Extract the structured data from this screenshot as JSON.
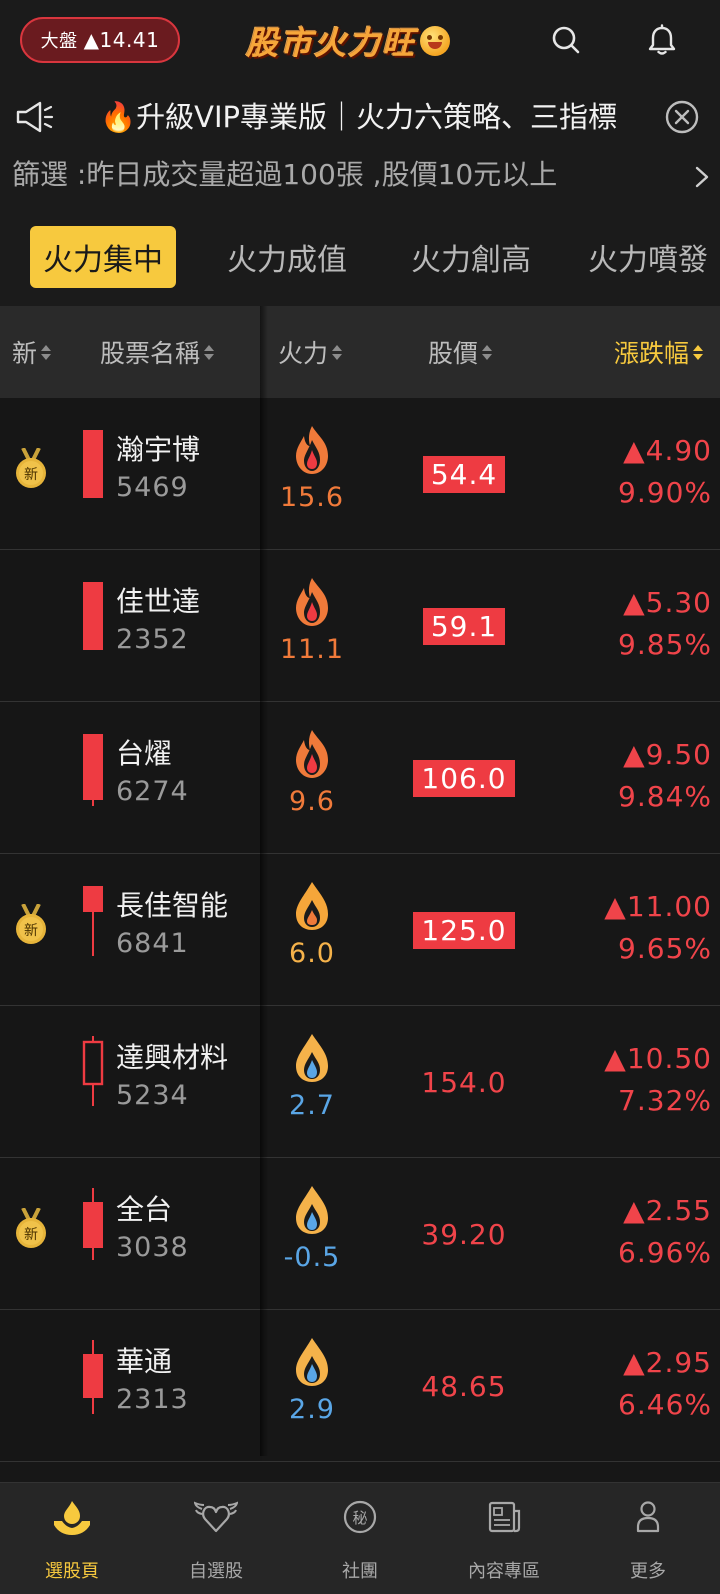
{
  "header": {
    "index_label": "大盤",
    "index_change": "▲14.41",
    "app_title": "股市火力旺"
  },
  "announcement": {
    "text": "🔥升級VIP專業版｜火力六策略、三指標"
  },
  "filter": {
    "text": "篩選 :昨日成交量超過100張 ,股價10元以上"
  },
  "tabs": [
    {
      "label": "火力集中",
      "active": true
    },
    {
      "label": "火力成值",
      "active": false
    },
    {
      "label": "火力創高",
      "active": false
    },
    {
      "label": "火力噴發",
      "active": false
    }
  ],
  "columns": {
    "new": "新",
    "name": "股票名稱",
    "fire": "火力",
    "price": "股價",
    "change": "漲跌幅"
  },
  "rows": [
    {
      "new": true,
      "name": "瀚宇博",
      "code": "5469",
      "fire": "15.6",
      "price": "54.4",
      "price_highlight": true,
      "change": "▲4.90",
      "pct": "9.90%"
    },
    {
      "new": false,
      "name": "佳世達",
      "code": "2352",
      "fire": "11.1",
      "price": "59.1",
      "price_highlight": true,
      "change": "▲5.30",
      "pct": "9.85%"
    },
    {
      "new": false,
      "name": "台燿",
      "code": "6274",
      "fire": "9.6",
      "price": "106.0",
      "price_highlight": true,
      "change": "▲9.50",
      "pct": "9.84%"
    },
    {
      "new": true,
      "name": "長佳智能",
      "code": "6841",
      "fire": "6.0",
      "price": "125.0",
      "price_highlight": true,
      "change": "▲11.00",
      "pct": "9.65%"
    },
    {
      "new": false,
      "name": "達興材料",
      "code": "5234",
      "fire": "2.7",
      "price": "154.0",
      "price_highlight": false,
      "change": "▲10.50",
      "pct": "7.32%"
    },
    {
      "new": true,
      "name": "全台",
      "code": "3038",
      "fire": "-0.5",
      "price": "39.20",
      "price_highlight": false,
      "change": "▲2.55",
      "pct": "6.96%"
    },
    {
      "new": false,
      "name": "華通",
      "code": "2313",
      "fire": "2.9",
      "price": "48.65",
      "price_highlight": false,
      "change": "▲2.95",
      "pct": "6.46%"
    }
  ],
  "medal_label": "新",
  "bottom_nav": [
    {
      "label": "選股頁",
      "icon": "flame-hand-icon",
      "active": true
    },
    {
      "label": "自選股",
      "icon": "winged-heart-icon",
      "active": false
    },
    {
      "label": "社團",
      "icon": "secret-badge-icon",
      "active": false
    },
    {
      "label": "內容專區",
      "icon": "news-icon",
      "active": false
    },
    {
      "label": "更多",
      "icon": "person-icon",
      "active": false
    }
  ],
  "colors": {
    "accent": "#f7c93e",
    "up_red": "#f0444a",
    "fire_orange": "#f07a3a",
    "fire_amber": "#f5b24a",
    "fire_blue": "#5aa6e6"
  }
}
